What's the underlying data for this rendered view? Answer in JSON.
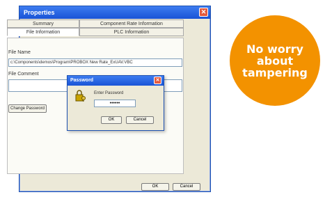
{
  "window": {
    "title": "Properties",
    "tabs": [
      {
        "label": "Summary"
      },
      {
        "label": "Component Rate Information"
      },
      {
        "label": "File Information"
      },
      {
        "label": "PLC Information"
      }
    ],
    "file_name_label": "File Name",
    "file_name_value": "c:\\Components\\demos\\Program\\PROBOX New Rate_ExUAV.VBC",
    "file_comment_label": "File Comment",
    "change_password_label": "Change Password",
    "ok_label": "OK",
    "cancel_label": "Cancel"
  },
  "dialog": {
    "title": "Password",
    "prompt": "Enter Password",
    "password_masked": "••••••",
    "ok_label": "OK",
    "cancel_label": "Cancel"
  },
  "badge": {
    "text": "No worry about tampering",
    "color": "#f39200"
  }
}
